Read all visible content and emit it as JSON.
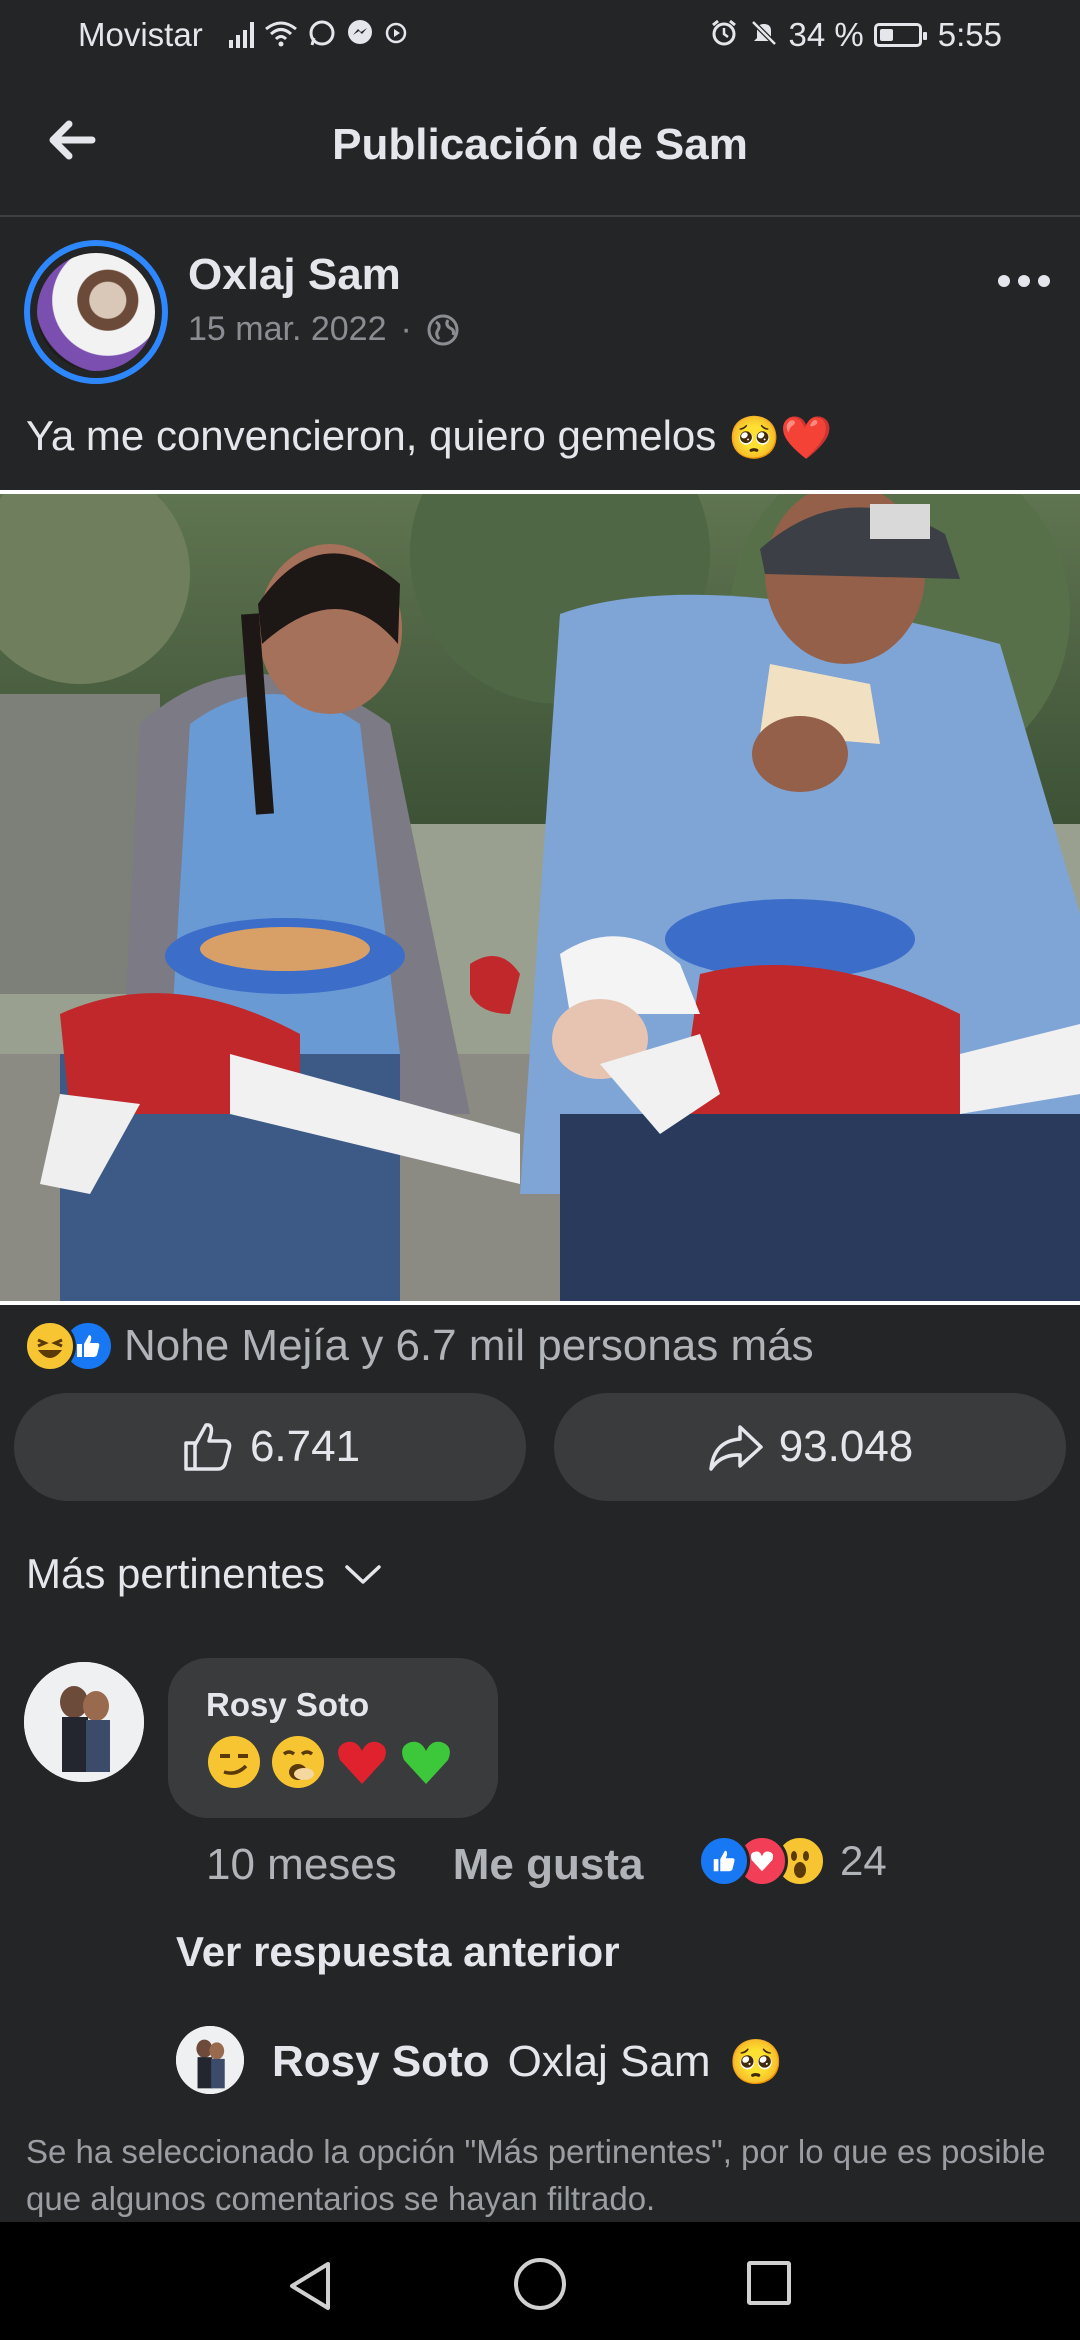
{
  "status_bar": {
    "carrier": "Movistar",
    "battery": "34 %",
    "time": "5:55"
  },
  "header": {
    "title": "Publicación de Sam",
    "back_icon": "arrow-left-icon"
  },
  "post": {
    "author": "Oxlaj Sam",
    "date": "15 mar. 2022",
    "separator": "·",
    "privacy_icon": "globe-icon",
    "text": "Ya me convencieron, quiero gemelos",
    "text_emojis": [
      "🥺",
      "❤️"
    ]
  },
  "reactions": {
    "icons": [
      "haha",
      "like"
    ],
    "summary": "Nohe Mejía y 6.7 mil personas más"
  },
  "actions": {
    "like_count": "6.741",
    "share_count": "93.048"
  },
  "comments": {
    "filter_label": "Más pertinentes",
    "items": [
      {
        "author": "Rosy Soto",
        "content_emojis": [
          "😏",
          "🥱",
          "❤️",
          "💚"
        ],
        "time": "10 meses",
        "like_label": "Me gusta",
        "reaction_icons": [
          "like",
          "love",
          "wow"
        ],
        "reaction_count": "24",
        "view_previous": "Ver respuesta anterior",
        "reply": {
          "author": "Rosy Soto",
          "mention": "Oxlaj Sam",
          "emoji": "🥺"
        }
      }
    ],
    "filter_note": "Se ha seleccionado la opción \"Más pertinentes\", por lo que es posible que algunos comentarios se hayan filtrado."
  },
  "colors": {
    "background": "#242526",
    "button": "#3a3b3c",
    "accent": "#2d88ff",
    "like_blue": "#1877f2",
    "love_red": "#f33e58",
    "haha_yellow": "#f7c532"
  }
}
